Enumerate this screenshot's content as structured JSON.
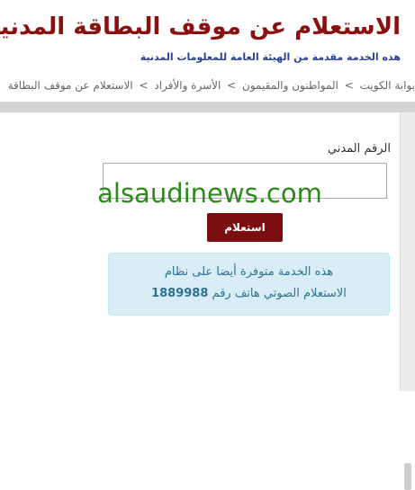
{
  "header": {
    "title": "الاستعلام عن موقف البطاقة المدنية",
    "subtitle": "هذه الخدمة مقدمة من الهيئة العامة للمعلومات المدنية"
  },
  "breadcrumb": {
    "items": [
      "بوابة الكويت",
      "المواطنون والمقيمون",
      "الأسرة والأفراد",
      "الاستعلام عن موقف البطاقة"
    ],
    "separator": ">"
  },
  "form": {
    "civil_id_label": "الرقم المدني",
    "civil_id_value": "",
    "submit_label": "استعلام"
  },
  "watermark": "alsaudinews.com",
  "info": {
    "line1": "هذه الخدمة متوفرة أيضا على نظام",
    "line2_prefix": "الاستعلام الصوتي هاتف رقم",
    "phone": "1889988"
  },
  "colors": {
    "title": "#8b1010",
    "subtitle": "#2a3f9c",
    "button": "#7a0e10",
    "info_bg": "#d9edf7",
    "info_text": "#31708f",
    "watermark": "#2c8a1a"
  }
}
